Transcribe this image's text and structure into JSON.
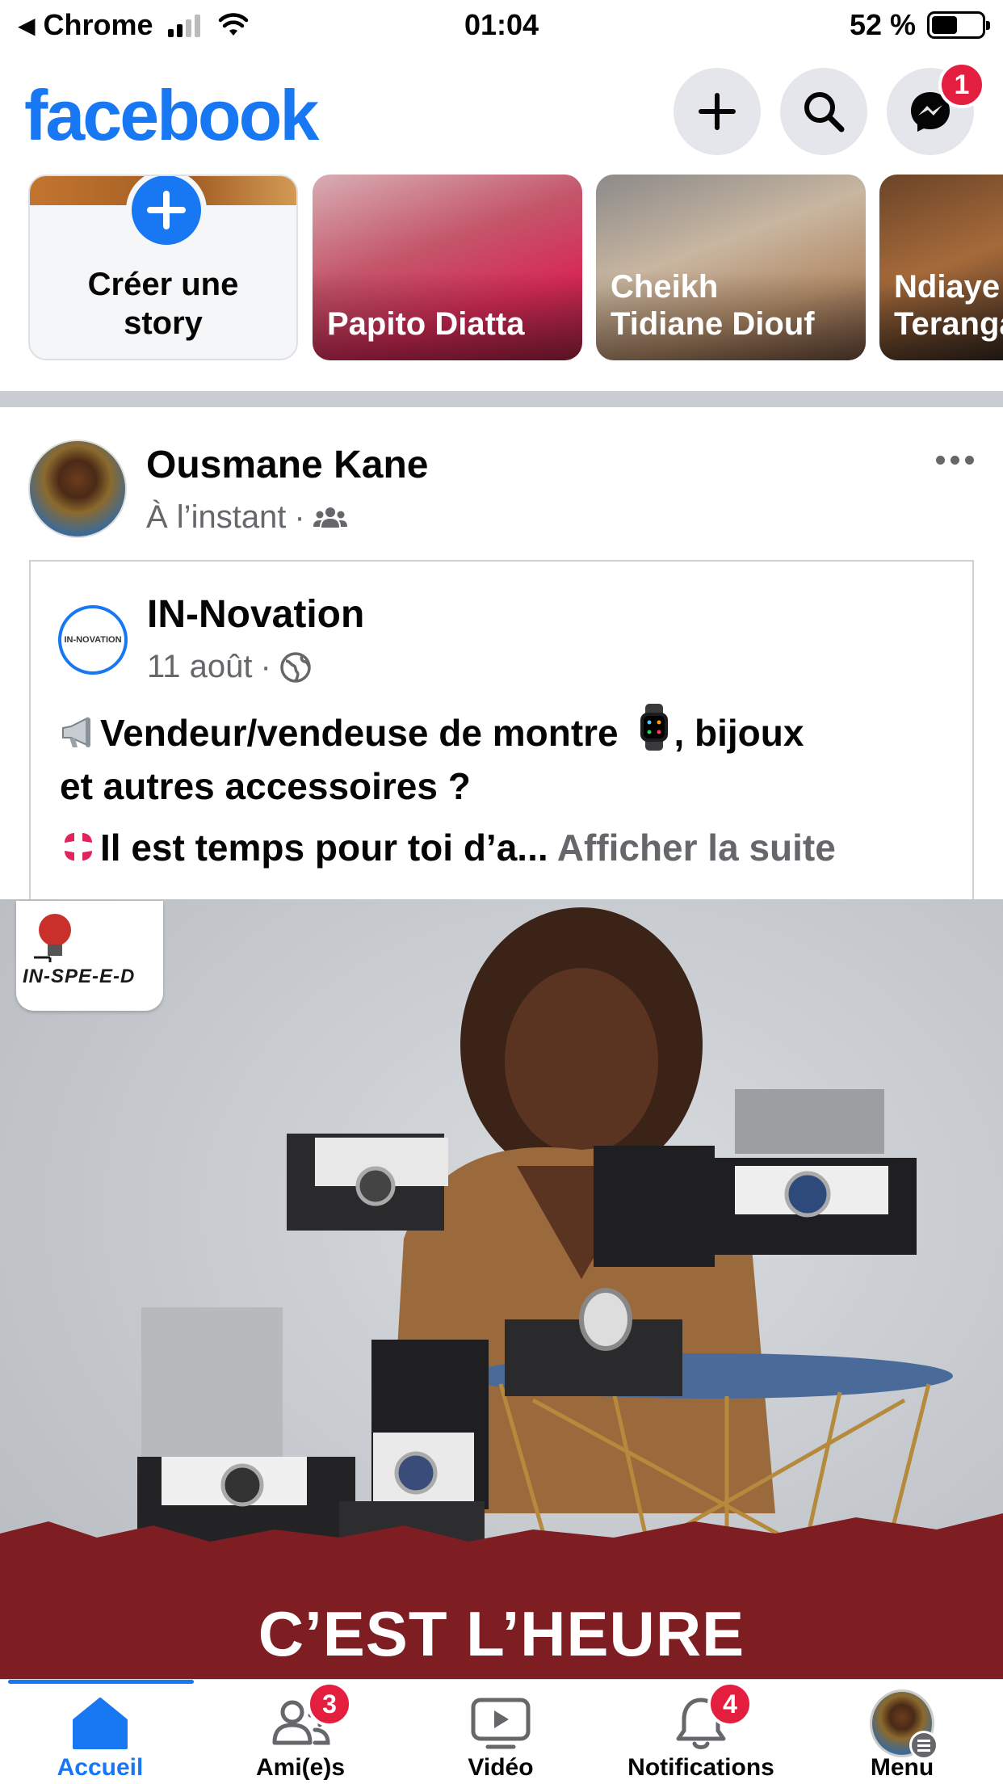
{
  "status_bar": {
    "back_app": "Chrome",
    "time": "01:04",
    "battery_percent": "52 %",
    "battery_level": 0.52
  },
  "header": {
    "logo": "facebook",
    "messenger_badge": "1"
  },
  "stories": {
    "create_label": "Créer une\nstory",
    "items": [
      {
        "name": "Papito Diatta"
      },
      {
        "name": "Cheikh\nTidiane Diouf"
      },
      {
        "name": "Ndiaye\nTeranga"
      }
    ]
  },
  "post": {
    "author": "Ousmane Kane",
    "time": "À l’instant",
    "shared": {
      "page_name": "IN-Novation",
      "page_avatar_text": "IN-NOVATION",
      "date": "11 août",
      "text_line1": "Vendeur/vendeuse de montre",
      "text_line1b": ", bijoux",
      "text_line2": "et autres accessoires ?",
      "text_line3": "Il est temps pour toi d’a...",
      "see_more": "Afficher la suite"
    },
    "image": {
      "logo_text": "IN-SPE-E-D",
      "caption": "C’EST L’HEURE"
    }
  },
  "bottom_nav": {
    "items": [
      {
        "label": "Accueil",
        "icon": "home-icon"
      },
      {
        "label": "Ami(e)s",
        "icon": "friends-icon",
        "badge": "3"
      },
      {
        "label": "Vidéo",
        "icon": "video-icon"
      },
      {
        "label": "Notifications",
        "icon": "bell-icon",
        "badge": "4"
      },
      {
        "label": "Menu",
        "icon": "menu-avatar"
      }
    ]
  },
  "colors": {
    "brand": "#1877f2",
    "badge": "#e41e3f",
    "banner": "#7e1d22"
  }
}
